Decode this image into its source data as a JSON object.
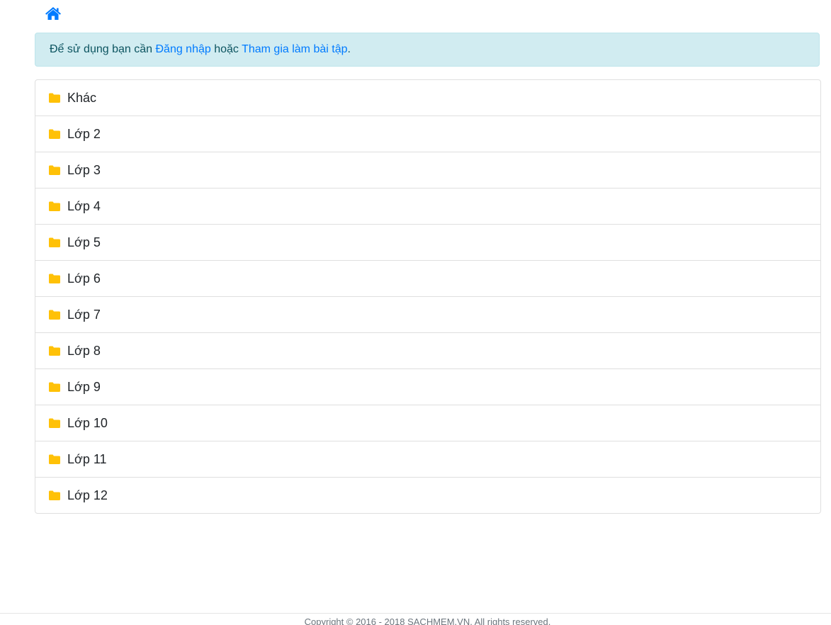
{
  "nav": {
    "home_icon": "home-icon",
    "accent_color": "#007bff"
  },
  "alert": {
    "text_before": "Để sử dụng bạn cần ",
    "login_link": "Đăng nhập",
    "text_middle": " hoặc ",
    "join_link": "Tham gia làm bài tập",
    "text_after": ".",
    "background_color": "#d1ecf1"
  },
  "categories": {
    "icon": "folder-icon",
    "icon_color": "#ffc107",
    "items": [
      {
        "label": "Khác"
      },
      {
        "label": "Lớp 2"
      },
      {
        "label": "Lớp 3"
      },
      {
        "label": "Lớp 4"
      },
      {
        "label": "Lớp 5"
      },
      {
        "label": "Lớp 6"
      },
      {
        "label": "Lớp 7"
      },
      {
        "label": "Lớp 8"
      },
      {
        "label": "Lớp 9"
      },
      {
        "label": "Lớp 10"
      },
      {
        "label": "Lớp 11"
      },
      {
        "label": "Lớp 12"
      }
    ]
  },
  "footer": {
    "copyright": "Copyright © 2016 - 2018 SACHMEM.VN. All rights reserved."
  }
}
